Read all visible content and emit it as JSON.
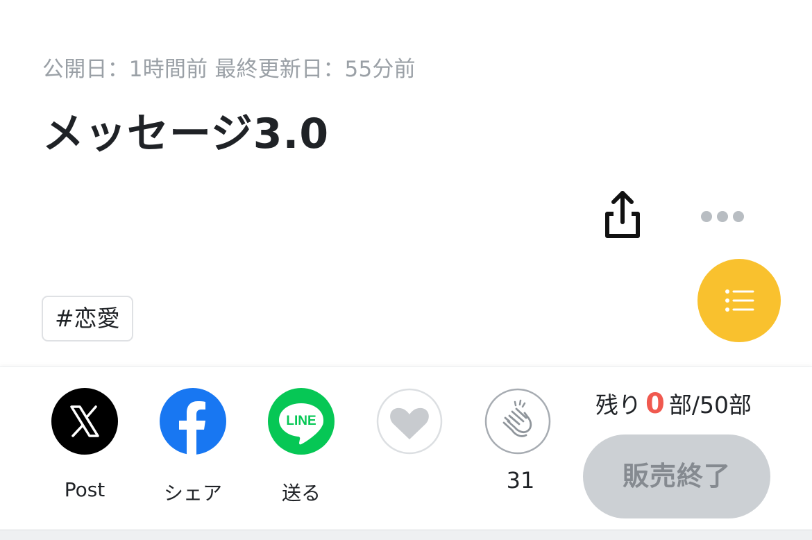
{
  "header": {
    "published_label": "公開日：1時間前",
    "updated_label": "最終更新日：55分前",
    "title": "メッセージ3.0"
  },
  "actions": {
    "share_icon": "share-icon",
    "more_icon": "more-horizontal-icon",
    "toc_icon": "list-icon"
  },
  "tags": [
    "#恋愛"
  ],
  "social": {
    "x_label": "Post",
    "facebook_label": "シェア",
    "line_label": "送る",
    "line_logo_text": "LINE"
  },
  "engagement": {
    "like_icon": "heart-icon",
    "clap_icon": "clap-icon",
    "clap_count": "31"
  },
  "sales": {
    "remaining_prefix": "残り",
    "remaining_count": "0",
    "remaining_suffix": "部/50部",
    "soldout_label": "販売終了"
  },
  "colors": {
    "accent_yellow": "#f9c12e",
    "facebook_blue": "#1877f2",
    "line_green": "#06c755",
    "remaining_red": "#f0594f",
    "soldout_gray": "#ccd0d4"
  }
}
